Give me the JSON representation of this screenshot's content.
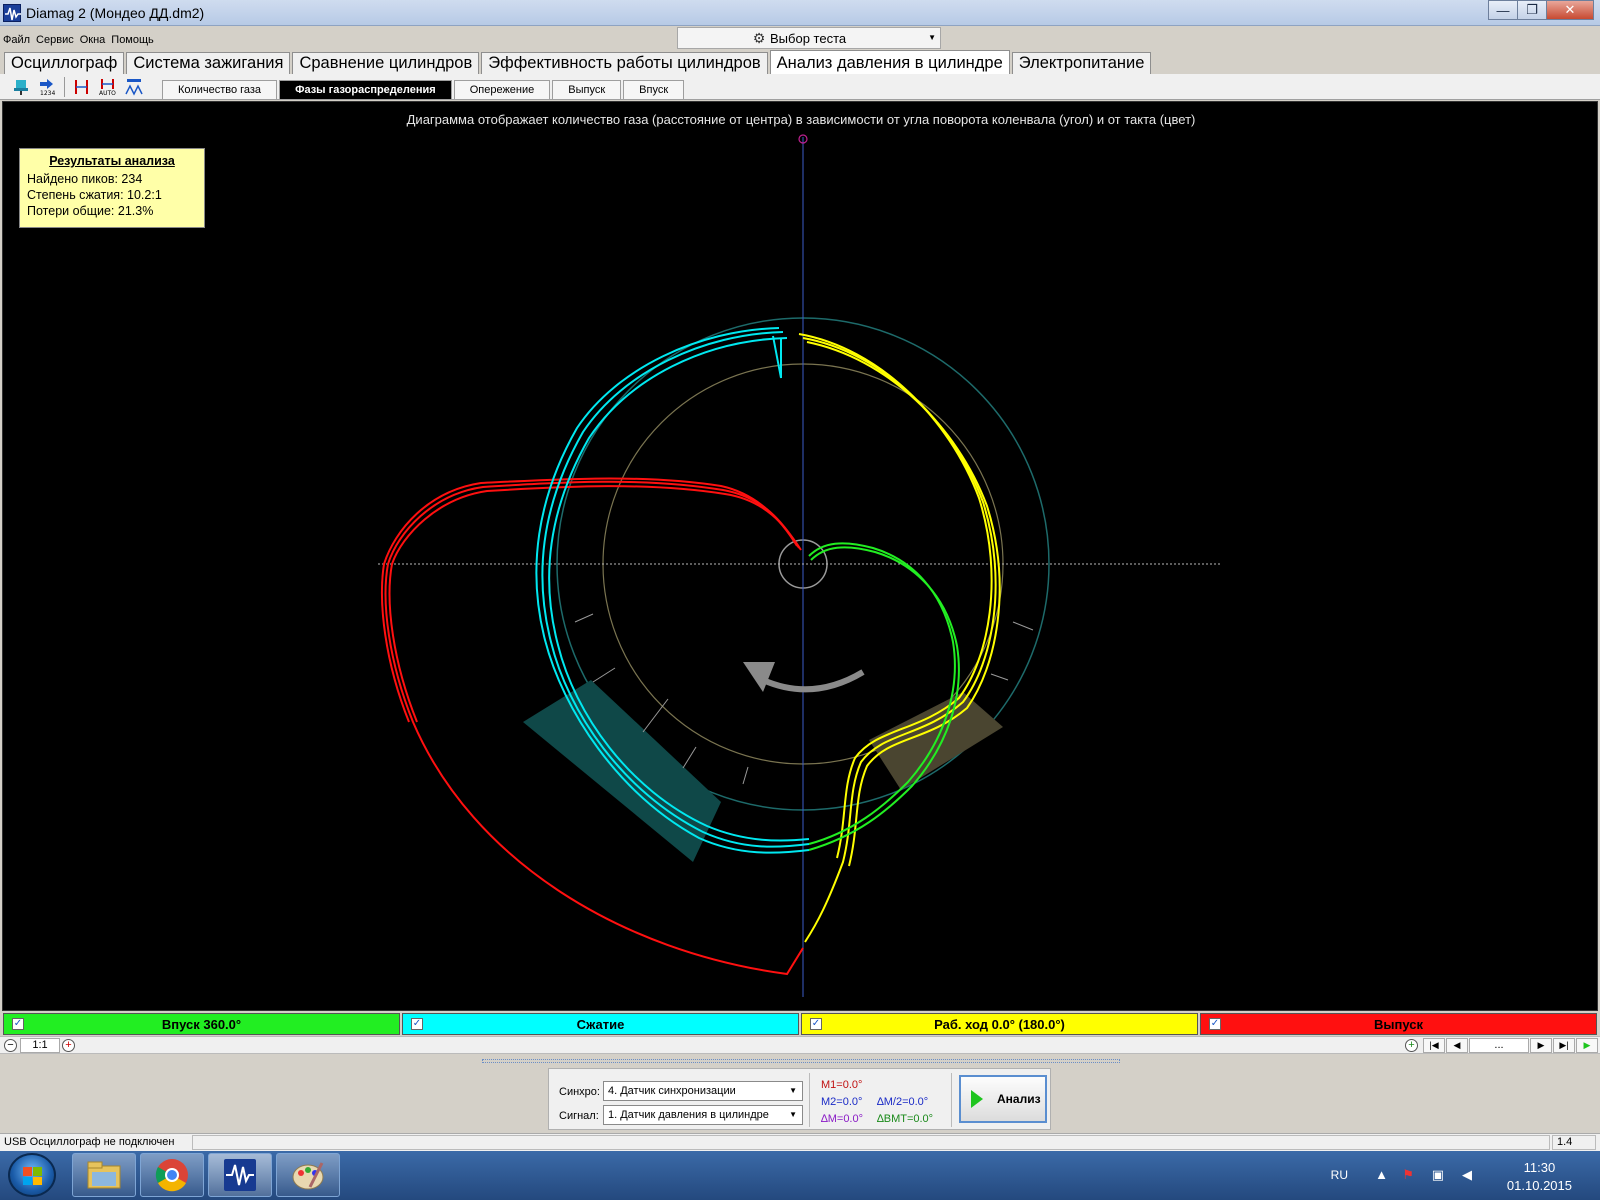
{
  "window": {
    "title": "Diamag 2 (Мондео ДД.dm2)",
    "minimize_glyph": "—",
    "maximize_glyph": "❐",
    "close_glyph": "✕"
  },
  "menu": [
    "Файл",
    "Сервис",
    "Окна",
    "Помощь"
  ],
  "test_select": {
    "label": "Выбор теста",
    "icon": "gear-icon"
  },
  "main_tabs": [
    {
      "label": "Осциллограф",
      "active": false
    },
    {
      "label": "Система зажигания",
      "active": false
    },
    {
      "label": "Сравнение цилиндров",
      "active": false
    },
    {
      "label": "Эффективность работы цилиндров",
      "active": false
    },
    {
      "label": "Анализ давления в цилиндре",
      "active": true
    },
    {
      "label": "Электропитание",
      "active": false
    }
  ],
  "toolbar_icons": [
    "cylinder-tool-icon",
    "numbering-tool-icon",
    "markers-tool-icon",
    "auto-markers-tool-icon",
    "scale-tool-icon"
  ],
  "sub_tabs": [
    {
      "label": "Количество газа",
      "active": false
    },
    {
      "label": "Фазы газораспределения",
      "active": true
    },
    {
      "label": "Опережение",
      "active": false
    },
    {
      "label": "Выпуск",
      "active": false
    },
    {
      "label": "Впуск",
      "active": false
    }
  ],
  "plot": {
    "caption": "Диаграмма отображает количество газа (расстояние от центра) в зависимости от угла поворота коленвала (угол) и от такта (цвет)",
    "background": "#000000"
  },
  "results": {
    "title": "Результаты анализа",
    "lines": [
      "Найдено пиков: 234",
      "Степень сжатия: 10.2:1",
      "Потери общие: 21.3%"
    ]
  },
  "legend": [
    {
      "label": "Впуск 360.0°",
      "color": "#22ee22",
      "checked": true
    },
    {
      "label": "Сжатие",
      "color": "#00ffff",
      "checked": true
    },
    {
      "label": "Раб. ход 0.0° (180.0°)",
      "color": "#ffff00",
      "checked": true
    },
    {
      "label": "Выпуск",
      "color": "#ff1010",
      "checked": true
    }
  ],
  "scale": {
    "label": "1:1",
    "nav_field": "...",
    "minus": "−",
    "plus": "+"
  },
  "nav_buttons": [
    "|◀",
    "◀",
    "▶",
    "▶|"
  ],
  "control": {
    "sync_label": "Синхро:",
    "sync_value": "4.  Датчик синхронизации",
    "signal_label": "Сигнал:",
    "signal_value": "1.  Датчик давления в цилиндре",
    "m1": "M1=0.0°",
    "m2": "M2=0.0°",
    "dm": "∆M=0.0°",
    "dm2": "∆M/2=0.0°",
    "dbmt": "∆BMT=0.0°",
    "analyze": "Анализ"
  },
  "status": {
    "text": "USB Осциллограф не подключен",
    "version": "1.4"
  },
  "taskbar": {
    "apps": [
      "explorer-icon",
      "chrome-icon",
      "diamag-icon",
      "paint-icon"
    ],
    "lang": "RU",
    "time": "11:30",
    "date": "01.10.2015"
  },
  "colors": {
    "intake": "#22ee22",
    "compression": "#00ffff",
    "power": "#ffff00",
    "exhaust": "#ff1010",
    "sector_teal": "#0f4848",
    "sector_olive": "#4a4530"
  }
}
